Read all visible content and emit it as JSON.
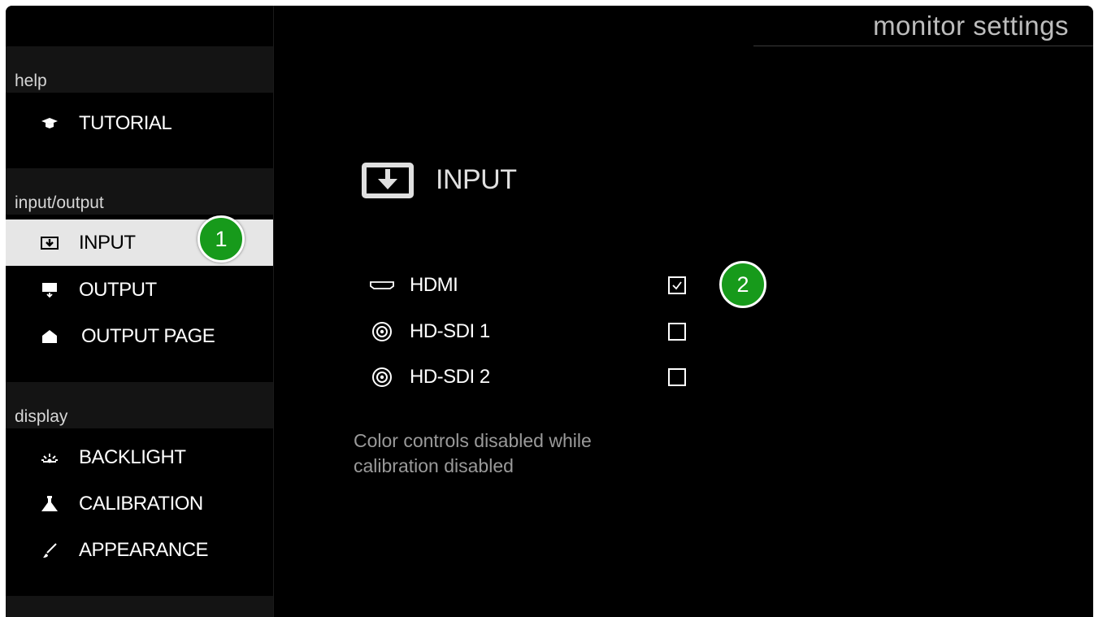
{
  "page": {
    "title": "monitor settings"
  },
  "sidebar": {
    "sections": [
      {
        "header": "help",
        "items": [
          {
            "label": "TUTORIAL",
            "icon": "graduation-cap-icon"
          }
        ]
      },
      {
        "header": "input/output",
        "items": [
          {
            "label": "INPUT",
            "icon": "input-icon",
            "selected": true
          },
          {
            "label": "OUTPUT",
            "icon": "monitor-output-icon"
          },
          {
            "label": "OUTPUT PAGE",
            "icon": "home-icon"
          }
        ]
      },
      {
        "header": "display",
        "items": [
          {
            "label": "BACKLIGHT",
            "icon": "backlight-icon"
          },
          {
            "label": "CALIBRATION",
            "icon": "calibration-icon"
          },
          {
            "label": "APPEARANCE",
            "icon": "brush-icon"
          }
        ]
      }
    ]
  },
  "main": {
    "section_title": "INPUT",
    "section_icon": "input-icon",
    "inputs": [
      {
        "label": "HDMI",
        "icon": "hdmi-icon",
        "checked": true
      },
      {
        "label": "HD-SDI 1",
        "icon": "sdi-icon",
        "checked": false
      },
      {
        "label": "HD-SDI 2",
        "icon": "sdi-icon",
        "checked": false
      }
    ],
    "note": "Color controls disabled while calibration disabled"
  },
  "annotations": {
    "badge1": "1",
    "badge2": "2"
  },
  "colors": {
    "accent_green": "#179a1b",
    "selected_bg": "#e6e6e6",
    "background": "#000000"
  }
}
